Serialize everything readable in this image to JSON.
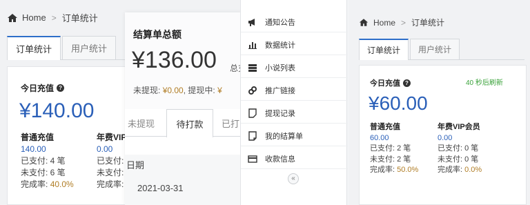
{
  "left_panel": {
    "breadcrumb": {
      "home": "Home",
      "separator": ">",
      "current": "订单统计"
    },
    "tabs": [
      "订单统计",
      "用户统计"
    ],
    "kpi_title": "今日充值",
    "help_icon": "question-circle-icon",
    "amount": "¥140.00",
    "col1": {
      "label": "普通充值",
      "value": "140.00",
      "paid": "已支付: 4 笔",
      "unpaid": "未支付: 6 笔",
      "rate_label": "完成率:",
      "rate": "40.0%"
    },
    "col2": {
      "label": "年费VIP",
      "value": "0.00",
      "paid": "已支付:",
      "unpaid": "未支付:",
      "rate_label": "完成率:"
    }
  },
  "middle_panel": {
    "title": "结算单总额",
    "amount": "¥136.00",
    "side_text": "总充",
    "withdraw_line": {
      "not_label": "未提现:",
      "not_value": "¥0.00",
      "sep": ",",
      "pending_label": "提现中:",
      "pending_value": "¥"
    },
    "tabs": [
      "未提现",
      "待打款",
      "已打"
    ],
    "date_header": "日期",
    "date_value": "2021-03-31"
  },
  "menu": {
    "items": [
      {
        "label": "通知公告",
        "icon": "megaphone-icon"
      },
      {
        "label": "数据统计",
        "icon": "bar-chart-icon"
      },
      {
        "label": "小说列表",
        "icon": "list-icon"
      },
      {
        "label": "推广链接",
        "icon": "link-icon"
      },
      {
        "label": "提现记录",
        "icon": "note-icon"
      },
      {
        "label": "我的结算单",
        "icon": "document-icon"
      },
      {
        "label": "收款信息",
        "icon": "credit-card-icon"
      }
    ],
    "collapse_icon": "collapse-left-icon"
  },
  "right_panel": {
    "breadcrumb": {
      "home": "Home",
      "separator": ">",
      "current": "订单统计"
    },
    "tabs": [
      "订单统计",
      "用户统计"
    ],
    "kpi_title": "今日充值",
    "refresh_text": "40 秒后刷新",
    "amount": "¥60.00",
    "col1": {
      "label": "普通充值",
      "value": "60.00",
      "paid": "已支付: 2 笔",
      "unpaid": "未支付: 2 笔",
      "rate_label": "完成率:",
      "rate": "50.0%"
    },
    "col2": {
      "label": "年费VIP会员",
      "value": "0.00",
      "paid": "已支付: 0 笔",
      "unpaid": "未支付: 0 笔",
      "rate_label": "完成率:",
      "rate": "0.0%"
    }
  },
  "colors": {
    "accent_blue": "#2a5fb8",
    "refresh_green": "#3aa23a",
    "rate_gold": "#b07d25"
  }
}
